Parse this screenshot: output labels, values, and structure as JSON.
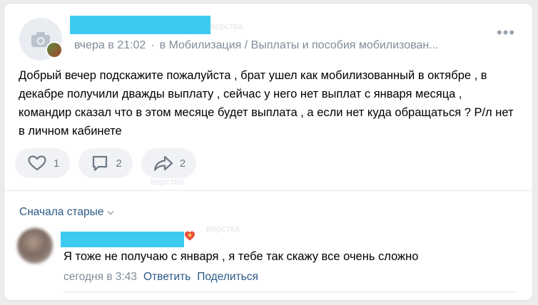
{
  "post": {
    "time": "вчера в 21:02",
    "separator": "·",
    "community": "в Мобилизация / Выплаты и пособия мобилизован...",
    "more_glyph": "•••",
    "text": "Добрый вечер подскажите пожалуйста , брат ушел как мобилизованный в октябре , в декабре получили дважды выплату , сейчас у него нет выплат с января месяца , командир сказал что в этом месяце будет выплата , а если нет куда обращаться ? Р/л нет в личном кабинете",
    "likes": "1",
    "comments": "2",
    "shares": "2"
  },
  "comments_sort": "Сначала старые",
  "comment": {
    "text": "Я тоже не получаю с января , я тебе так скажу все очень сложно",
    "time": "сегодня в 3:43",
    "reply": "Ответить",
    "share": "Поделиться"
  },
  "watermarks": [
    "верстка",
    "верстка",
    "верстка"
  ],
  "colors": {
    "link": "#2a5885",
    "secondary": "#818c99",
    "redaction": "#3ccaf0",
    "button_bg": "#f0f2f5"
  },
  "icons": [
    "camera-icon",
    "heart-icon",
    "comment-icon",
    "share-icon",
    "chevron-down-icon",
    "more-icon"
  ]
}
